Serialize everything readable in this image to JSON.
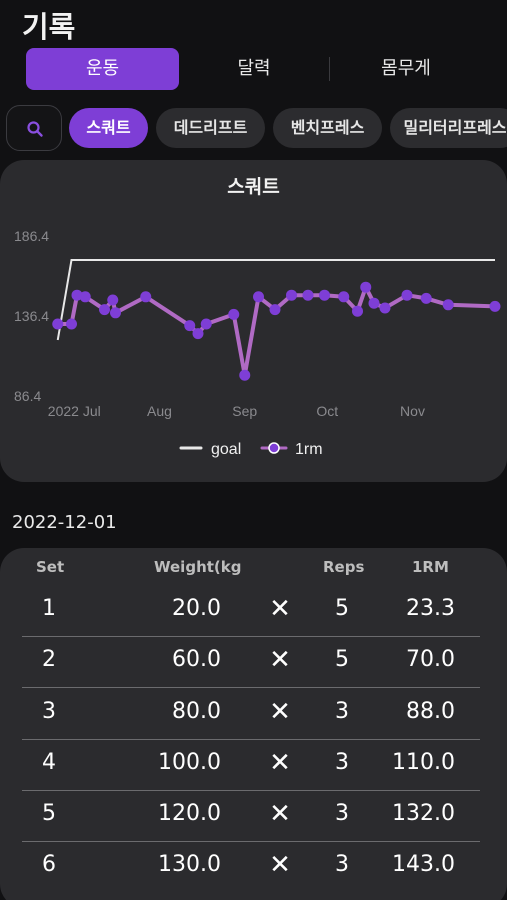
{
  "page_title": "기록",
  "tabs": [
    {
      "label": "운동",
      "active": true
    },
    {
      "label": "달력",
      "active": false
    },
    {
      "label": "몸무게",
      "active": false
    }
  ],
  "search_icon": "search-icon",
  "chips": [
    {
      "label": "스쿼트",
      "active": true
    },
    {
      "label": "데드리프트",
      "active": false
    },
    {
      "label": "벤치프레스",
      "active": false
    },
    {
      "label": "밀리터리프레스",
      "active": false
    }
  ],
  "colors": {
    "accent": "#7e3ed6",
    "line": "#b06ac4",
    "goal": "#e8e8e8",
    "card": "#2b2b2e",
    "background": "#111113"
  },
  "chart_data": {
    "type": "line",
    "title": "스쿼트",
    "y_ticks": [
      "186.4",
      "136.4",
      "86.4"
    ],
    "ylim": [
      86.4,
      186.4
    ],
    "x_ticks": [
      {
        "date": "2022-07-01",
        "label": "2022 Jul"
      },
      {
        "date": "2022-08-01",
        "label": "Aug"
      },
      {
        "date": "2022-09-01",
        "label": "Sep"
      },
      {
        "date": "2022-10-01",
        "label": "Oct"
      },
      {
        "date": "2022-11-01",
        "label": "Nov"
      }
    ],
    "x_range": [
      "2022-06-24",
      "2022-12-01"
    ],
    "legend": {
      "position": "bottom-center",
      "items": [
        {
          "label": "goal"
        },
        {
          "label": "1rm"
        }
      ]
    },
    "series": [
      {
        "name": "goal",
        "points": [
          {
            "x": "2022-06-25",
            "y": 121.4
          },
          {
            "x": "2022-06-30",
            "y": 171.4
          },
          {
            "x": "2022-12-01",
            "y": 171.4
          }
        ]
      },
      {
        "name": "1rm",
        "points": [
          {
            "x": "2022-06-25",
            "y": 131.4
          },
          {
            "x": "2022-06-30",
            "y": 131.4
          },
          {
            "x": "2022-07-02",
            "y": 149.4
          },
          {
            "x": "2022-07-05",
            "y": 148.4
          },
          {
            "x": "2022-07-12",
            "y": 140.4
          },
          {
            "x": "2022-07-15",
            "y": 146.4
          },
          {
            "x": "2022-07-16",
            "y": 138.4
          },
          {
            "x": "2022-07-27",
            "y": 148.4
          },
          {
            "x": "2022-08-12",
            "y": 130.4
          },
          {
            "x": "2022-08-15",
            "y": 125.4
          },
          {
            "x": "2022-08-18",
            "y": 131.4
          },
          {
            "x": "2022-08-28",
            "y": 137.4
          },
          {
            "x": "2022-09-01",
            "y": 99.4
          },
          {
            "x": "2022-09-06",
            "y": 148.4
          },
          {
            "x": "2022-09-12",
            "y": 140.4
          },
          {
            "x": "2022-09-18",
            "y": 149.4
          },
          {
            "x": "2022-09-24",
            "y": 149.4
          },
          {
            "x": "2022-09-30",
            "y": 149.4
          },
          {
            "x": "2022-10-07",
            "y": 148.4
          },
          {
            "x": "2022-10-12",
            "y": 139.4
          },
          {
            "x": "2022-10-15",
            "y": 154.4
          },
          {
            "x": "2022-10-18",
            "y": 144.4
          },
          {
            "x": "2022-10-22",
            "y": 141.4
          },
          {
            "x": "2022-10-30",
            "y": 149.4
          },
          {
            "x": "2022-11-06",
            "y": 147.4
          },
          {
            "x": "2022-11-14",
            "y": 143.4
          },
          {
            "x": "2022-12-01",
            "y": 142.4
          }
        ]
      }
    ]
  },
  "date_label": "2022-12-01",
  "table": {
    "headers": {
      "set": "Set",
      "weight": "Weight(kg",
      "reps": "Reps",
      "orm": "1RM"
    },
    "cross_symbol": "✕",
    "rows": [
      {
        "set": "1",
        "weight": "20.0",
        "reps": "5",
        "orm": "23.3"
      },
      {
        "set": "2",
        "weight": "60.0",
        "reps": "5",
        "orm": "70.0"
      },
      {
        "set": "3",
        "weight": "80.0",
        "reps": "3",
        "orm": "88.0"
      },
      {
        "set": "4",
        "weight": "100.0",
        "reps": "3",
        "orm": "110.0"
      },
      {
        "set": "5",
        "weight": "120.0",
        "reps": "3",
        "orm": "132.0"
      },
      {
        "set": "6",
        "weight": "130.0",
        "reps": "3",
        "orm": "143.0"
      }
    ]
  }
}
